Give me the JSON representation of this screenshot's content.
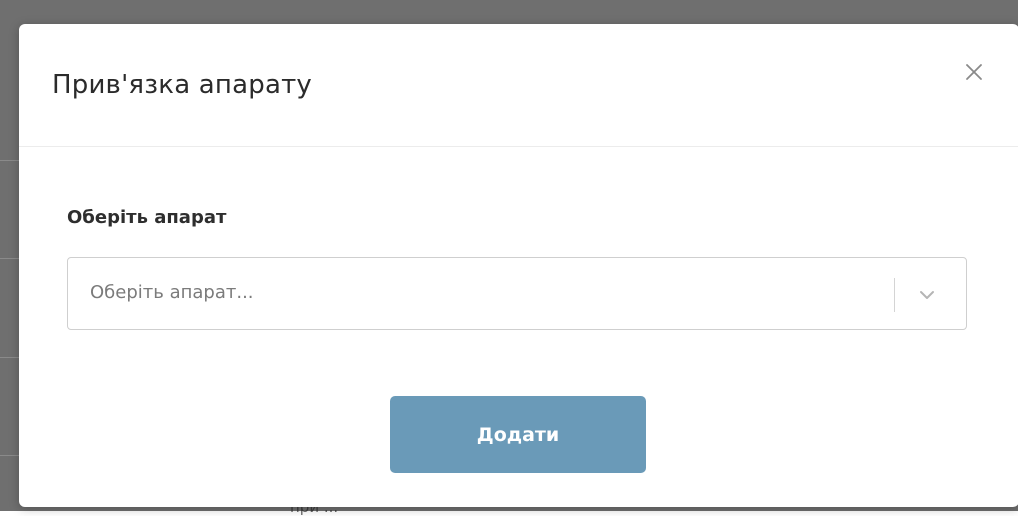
{
  "background": {
    "partial_text": "при ...",
    "overlay_color": "#6f6f6f"
  },
  "modal": {
    "title": "Прив'язка апарату",
    "close_icon": "close-icon",
    "field": {
      "label": "Оберіть апарат",
      "placeholder": "Оберіть апарат...",
      "value": "",
      "dropdown_icon": "chevron-down-icon"
    },
    "submit_label": "Додати",
    "colors": {
      "button": "#6a9ab8",
      "title": "#2b2b2b",
      "placeholder": "#7b7b7b"
    }
  }
}
